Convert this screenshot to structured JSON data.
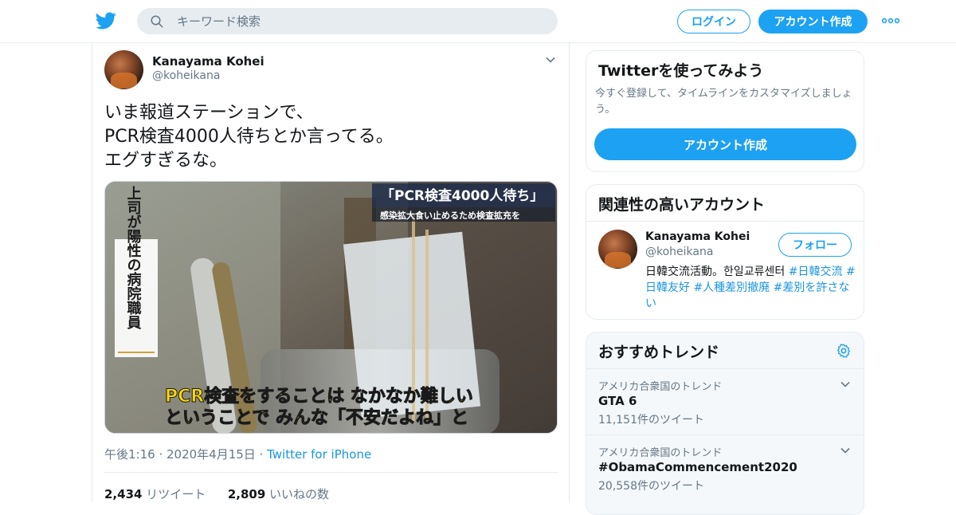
{
  "header": {
    "search_placeholder": "キーワード検索",
    "login_label": "ログイン",
    "signup_label": "アカウント作成",
    "brand_color": "#1da1f2"
  },
  "tweet": {
    "display_name": "Kanayama Kohei",
    "screen_name": "@koheikana",
    "text": "いま報道ステーションで、\nPCR検査4000人待ちとか言ってる。\nエグすぎるな。",
    "media": {
      "caption_top_title": "「PCR検査4000人待ち」",
      "caption_top_sub": "感染拡大食い止めるため検査拡充を",
      "caption_side": "上司が陽性の病院職員",
      "subtitle_line1": "PCR検査をすることは なかなか難しい",
      "subtitle_line2": "ということで みんな「不安だよね」と"
    },
    "time": "午後1:16 · 2020年4月15日 · ",
    "source": "Twitter for iPhone",
    "retweets_count": "2,434",
    "retweets_label": "リツイート",
    "likes_count": "2,809",
    "likes_label": "いいねの数"
  },
  "sidebar": {
    "signup_card": {
      "title": "Twitterを使ってみよう",
      "desc": "今すぐ登録して、タイムラインをカスタマイズしましょう。",
      "button": "アカウント作成"
    },
    "related": {
      "title": "関連性の高いアカウント",
      "name": "Kanayama Kohei",
      "handle": "@koheikana",
      "follow_label": "フォロー",
      "bio_text": "日韓交流活動。한일교류센터 ",
      "bio_tags": [
        "#日韓交流",
        "#日韓友好",
        "#人種差別撤廃",
        "#差別を許さない"
      ]
    },
    "trends": {
      "title": "おすすめトレンド",
      "items": [
        {
          "context": "アメリカ合衆国のトレンド",
          "name": "GTA 6",
          "count": "11,151件のツイート"
        },
        {
          "context": "アメリカ合衆国のトレンド",
          "name": "#ObamaCommencement2020",
          "count": "20,558件のツイート"
        }
      ]
    }
  }
}
